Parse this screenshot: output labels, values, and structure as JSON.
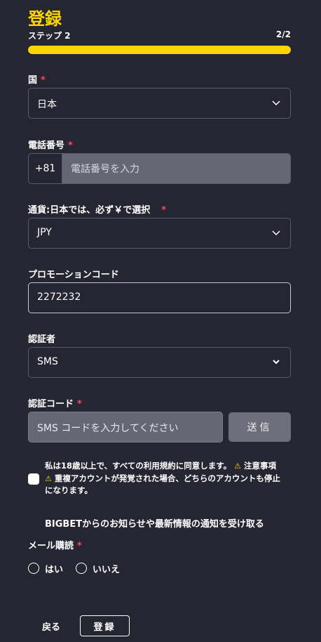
{
  "header": {
    "title": "登録",
    "step_label": "ステップ 2",
    "step_count": "2/2",
    "progress_fraction": 1.0
  },
  "colors": {
    "accent": "#ffd500",
    "required": "#ff4466",
    "background": "#262633"
  },
  "country": {
    "label": "国",
    "required": "*",
    "value": "日本",
    "icon": "chevron-down-icon"
  },
  "phone": {
    "label": "電話番号",
    "required": "*",
    "prefix": "+81",
    "placeholder": "電話番号を入力"
  },
  "currency": {
    "label": "通貨:日本では、必ず￥で選択",
    "required": "*",
    "value": "JPY",
    "icon": "chevron-down-icon"
  },
  "promo": {
    "label": "プロモーションコード",
    "value": "2272232"
  },
  "verifier": {
    "label": "認証者",
    "value": "SMS",
    "icon": "chevron-down-icon"
  },
  "verification": {
    "label": "認証コード",
    "required": "*",
    "placeholder": "SMS コードを入力してください",
    "send_label": "送信"
  },
  "terms": {
    "text1": "私は18歳以上で、すべての利用規約に同意します。",
    "warn1": "⚠",
    "text2": " 注意事項",
    "warn2": "⚠",
    "text3": " 重複アカウントが発覚された場合、どちらのアカウントも停止になります。"
  },
  "newsletter": {
    "text": "BIGBETからのお知らせや最新情報の通知を受け取る"
  },
  "subscription": {
    "label": "メール購読",
    "required": "*",
    "yes": "はい",
    "no": "いいえ"
  },
  "footer": {
    "back_label": "戻る",
    "submit_label": "登録"
  }
}
